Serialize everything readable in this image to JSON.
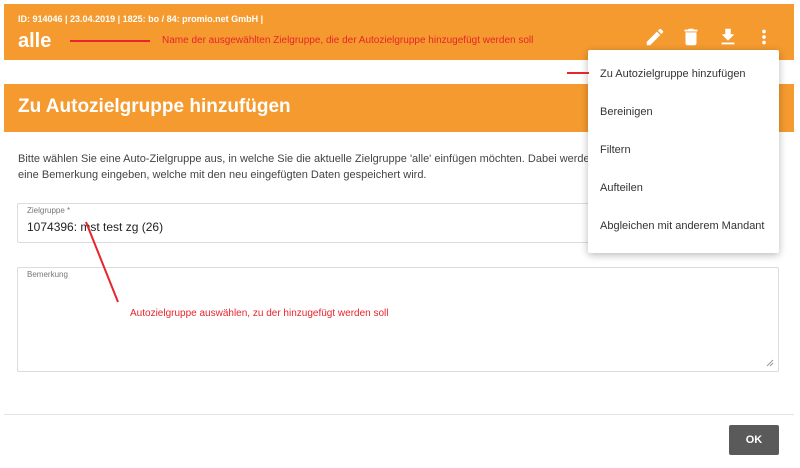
{
  "header": {
    "meta": "ID: 914046 | 23.04.2019 | 1825: bo / 84: promio.net GmbH |",
    "title": "alle",
    "icons": [
      "edit-icon",
      "delete-icon",
      "download-icon",
      "more-vert-icon"
    ],
    "background_color": "#f59a2f"
  },
  "annotations": {
    "name_note": "Name der ausgewählten Zielgruppe, die der Autozielgruppe hinzugefügt werden soll",
    "select_note": "Autozielgruppe auswählen, zu der hinzugefügt werden soll",
    "color": "#e8242c"
  },
  "dialog": {
    "title": "Zu Autozielgruppe hinzufügen",
    "description": "Bitte wählen Sie eine Auto-Zielgruppe aus, in welche Sie die aktuelle Zielgruppe 'alle' einfügen möchten. Dabei werden können zusätzlich eine Bemerkung eingeben, welche mit den neu eingefügten Daten gespeichert wird.",
    "zielgruppe_field": {
      "label": "Zielgruppe *",
      "value": "1074396: mst test zg (26)"
    },
    "bemerkung_field": {
      "label": "Bemerkung",
      "value": ""
    },
    "ok_label": "OK"
  },
  "menu": {
    "items": [
      {
        "label": "Zu Autozielgruppe hinzufügen"
      },
      {
        "label": "Bereinigen"
      },
      {
        "label": "Filtern"
      },
      {
        "label": "Aufteilen"
      },
      {
        "label": "Abgleichen mit anderem Mandant"
      }
    ]
  }
}
